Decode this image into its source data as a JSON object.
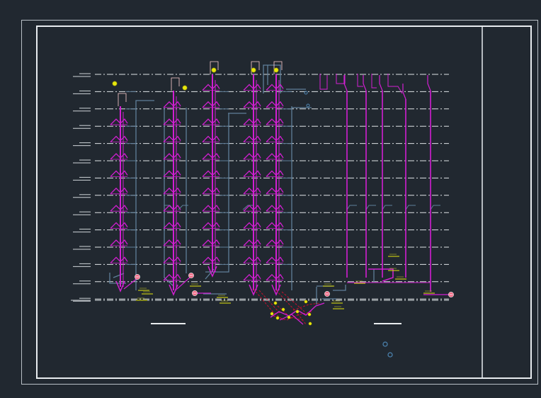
{
  "canvas": {
    "background": "#212830"
  },
  "colors": {
    "frame": "#e8ecef",
    "floor_line": "#dfe3e6",
    "pipe_magenta": "#d21fd2",
    "pipe_blue": "#5f7f9a",
    "pipe_red": "#c8102e",
    "tag_yellow": "#e7e70c",
    "valve_pink": "#f06a86",
    "cleanout_blue": "#4d86b4"
  },
  "floors": {
    "count": 14,
    "level_labels": [
      "",
      "",
      "",
      "",
      "",
      "",
      "",
      "",
      "",
      "",
      "",
      "",
      "",
      ""
    ]
  },
  "risers": {
    "with_branches": [
      "riser-1",
      "riser-2",
      "riser-3",
      "riser-4",
      "riser-5"
    ],
    "simple": [
      "riser-6",
      "riser-7",
      "riser-8",
      "riser-9",
      "riser-10"
    ]
  },
  "symbols": {
    "vent_caps": 5,
    "valves": 5,
    "cleanouts": 2
  },
  "icons": {
    "vent_cap": "yellow-circle-icon",
    "valve": "pink-circle-valve-icon",
    "cleanout": "blue-ring-icon"
  }
}
